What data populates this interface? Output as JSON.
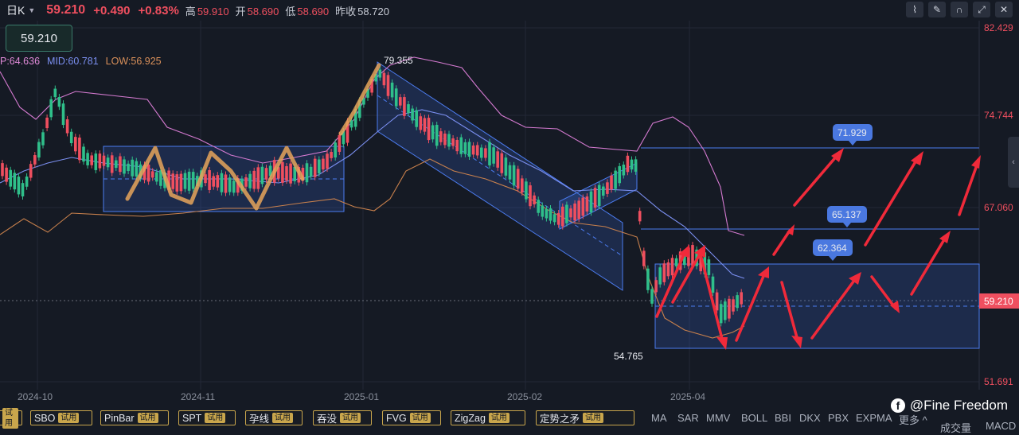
{
  "header": {
    "timeframe": "日K",
    "price": "59.210",
    "change": "+0.490",
    "change_pct": "+0.83%",
    "high_label": "高",
    "high": "59.910",
    "open_label": "开",
    "open": "58.690",
    "low_label": "低",
    "low": "58.690",
    "prev_close_label": "昨收",
    "prev_close": "58.720"
  },
  "tools": [
    "line-chart-icon",
    "pencil-icon",
    "magnet-icon",
    "fullscreen-icon",
    "close-icon"
  ],
  "price_box": "59.210",
  "boll_legend": {
    "up": "P:64.636",
    "mid": "MID:60.781",
    "low": "LOW:56.925"
  },
  "colors": {
    "up": "#ef4f5f",
    "down": "#2fbf8a",
    "accent": "#4c7cf0",
    "boll_up": "#e08ad8",
    "boll_mid": "#7b8ff0",
    "boll_low": "#d9905a",
    "arrow": "#f02a3a"
  },
  "y_axis": [
    "82.429",
    "74.744",
    "67.060",
    "59.210",
    "51.691"
  ],
  "x_axis": [
    "2024-10",
    "2024-11",
    "2025-01",
    "2025-02",
    "2025-04"
  ],
  "annotations": {
    "peak": "79.355",
    "trough": "54.765",
    "target1": "71.929",
    "target2": "65.137",
    "target3": "62.364"
  },
  "indicator_buttons": [
    {
      "label": "",
      "badge": "试用"
    },
    {
      "label": "SBO",
      "badge": "试用"
    },
    {
      "label": "PinBar",
      "badge": "试用"
    },
    {
      "label": "SPT",
      "badge": "试用"
    },
    {
      "label": "孕线",
      "badge": "试用"
    },
    {
      "label": "吞没",
      "badge": "试用"
    },
    {
      "label": "FVG",
      "badge": "试用"
    },
    {
      "label": "ZigZag",
      "badge": "试用"
    },
    {
      "label": "定势之矛",
      "badge": "试用"
    }
  ],
  "main_indicators": [
    "MA",
    "SAR",
    "MMV",
    "BOLL",
    "BBI",
    "DKX",
    "PBX",
    "EXPMA",
    "更多 ^",
    "成交量",
    "MACD"
  ],
  "watermark": "@Fine Freedom"
}
